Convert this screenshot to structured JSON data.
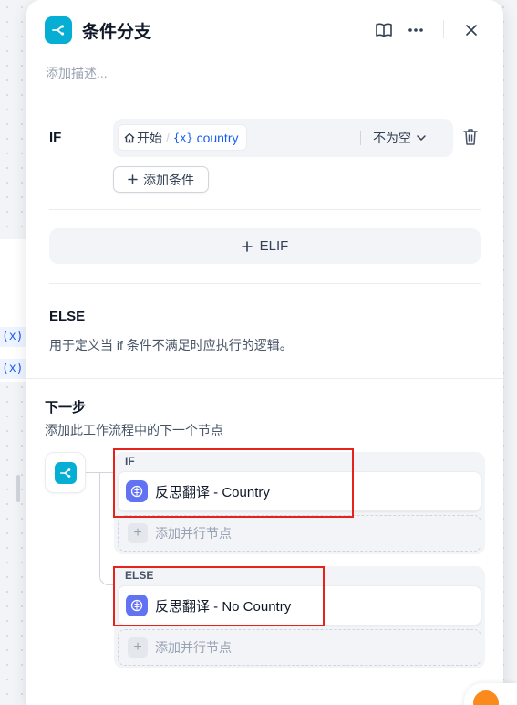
{
  "background": {
    "var_labels": [
      "(x) te",
      "(x) te"
    ]
  },
  "panel": {
    "title": "条件分支",
    "description_placeholder": "添加描述...",
    "icons": [
      "branch-icon",
      "book-icon",
      "more-icon",
      "close-icon"
    ]
  },
  "if_section": {
    "label": "IF",
    "condition": {
      "node_name": "开始",
      "separator": "/",
      "var_symbol": "{x}",
      "var_name": "country",
      "operator": "不为空"
    },
    "add_condition_label": "添加条件"
  },
  "elif_label": "ELIF",
  "else_section": {
    "label": "ELSE",
    "description": "用于定义当 if 条件不满足时应执行的逻辑。"
  },
  "next_step": {
    "title": "下一步",
    "description": "添加此工作流程中的下一个节点",
    "branches": [
      {
        "tag": "IF",
        "target": "反思翻译 - Country",
        "add_parallel": "添加并行节点"
      },
      {
        "tag": "ELSE",
        "target": "反思翻译 - No Country",
        "add_parallel": "添加并行节点"
      }
    ]
  },
  "colors": {
    "node_accent": "#06aed4",
    "llm_icon": "#6172f3",
    "variable": "#155eef",
    "highlight": "#e5231b"
  }
}
